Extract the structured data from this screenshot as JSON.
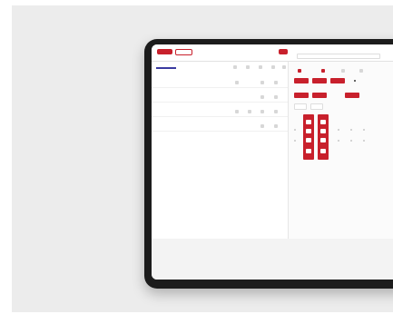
{
  "app": {
    "title": "",
    "accent_color": "#c8202c",
    "toolbar": {
      "primary_label": "",
      "secondary_label": "",
      "center_label": "",
      "right_header_label": ""
    },
    "left_panel": {
      "rows": [
        {
          "label": ""
        },
        {
          "label": ""
        },
        {
          "label": ""
        },
        {
          "label": ""
        }
      ]
    },
    "right_panel": {
      "labels": [
        "",
        "",
        ""
      ]
    }
  }
}
